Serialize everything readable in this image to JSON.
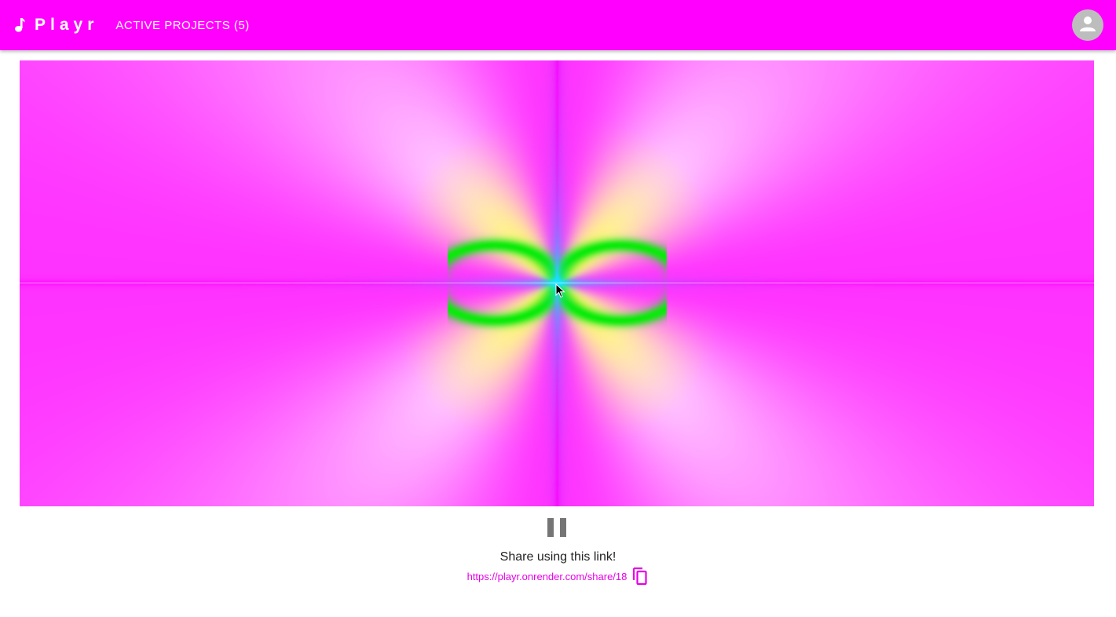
{
  "header": {
    "brand": "Playr",
    "brand_icon": "music-note-icon",
    "active_projects_label": "ACTIVE PROJECTS (5)",
    "avatar_icon": "account-icon",
    "background_color": "#ff00ff"
  },
  "visualizer": {
    "description_icon": "pattern-canvas",
    "playing": true
  },
  "controls": {
    "pause_icon": "pause-icon"
  },
  "share": {
    "text": "Share using this link!",
    "url": "https://playr.onrender.com/share/18",
    "copy_icon": "copy-icon",
    "accent_color": "#e600e6"
  }
}
